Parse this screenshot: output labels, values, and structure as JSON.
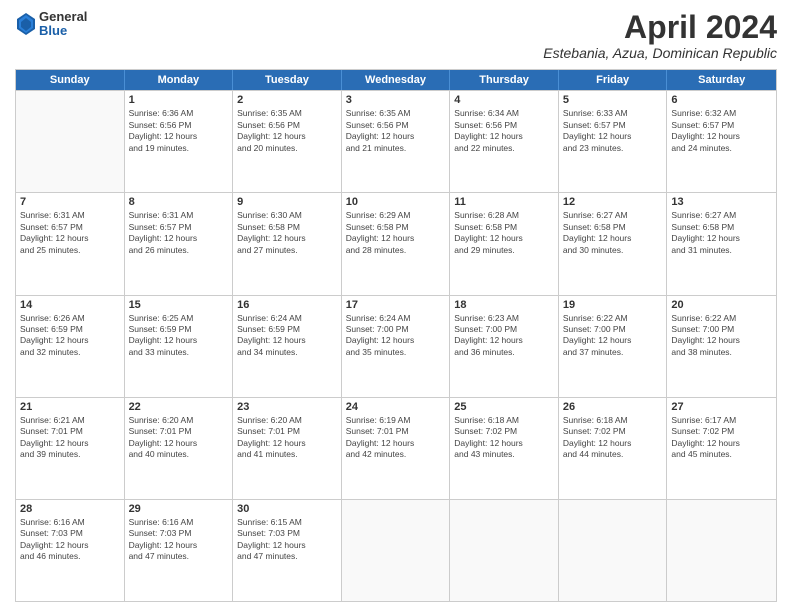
{
  "logo": {
    "general": "General",
    "blue": "Blue"
  },
  "title": "April 2024",
  "location": "Estebania, Azua, Dominican Republic",
  "header_days": [
    "Sunday",
    "Monday",
    "Tuesday",
    "Wednesday",
    "Thursday",
    "Friday",
    "Saturday"
  ],
  "weeks": [
    [
      {
        "day": "",
        "info": ""
      },
      {
        "day": "1",
        "info": "Sunrise: 6:36 AM\nSunset: 6:56 PM\nDaylight: 12 hours\nand 19 minutes."
      },
      {
        "day": "2",
        "info": "Sunrise: 6:35 AM\nSunset: 6:56 PM\nDaylight: 12 hours\nand 20 minutes."
      },
      {
        "day": "3",
        "info": "Sunrise: 6:35 AM\nSunset: 6:56 PM\nDaylight: 12 hours\nand 21 minutes."
      },
      {
        "day": "4",
        "info": "Sunrise: 6:34 AM\nSunset: 6:56 PM\nDaylight: 12 hours\nand 22 minutes."
      },
      {
        "day": "5",
        "info": "Sunrise: 6:33 AM\nSunset: 6:57 PM\nDaylight: 12 hours\nand 23 minutes."
      },
      {
        "day": "6",
        "info": "Sunrise: 6:32 AM\nSunset: 6:57 PM\nDaylight: 12 hours\nand 24 minutes."
      }
    ],
    [
      {
        "day": "7",
        "info": "Sunrise: 6:31 AM\nSunset: 6:57 PM\nDaylight: 12 hours\nand 25 minutes."
      },
      {
        "day": "8",
        "info": "Sunrise: 6:31 AM\nSunset: 6:57 PM\nDaylight: 12 hours\nand 26 minutes."
      },
      {
        "day": "9",
        "info": "Sunrise: 6:30 AM\nSunset: 6:58 PM\nDaylight: 12 hours\nand 27 minutes."
      },
      {
        "day": "10",
        "info": "Sunrise: 6:29 AM\nSunset: 6:58 PM\nDaylight: 12 hours\nand 28 minutes."
      },
      {
        "day": "11",
        "info": "Sunrise: 6:28 AM\nSunset: 6:58 PM\nDaylight: 12 hours\nand 29 minutes."
      },
      {
        "day": "12",
        "info": "Sunrise: 6:27 AM\nSunset: 6:58 PM\nDaylight: 12 hours\nand 30 minutes."
      },
      {
        "day": "13",
        "info": "Sunrise: 6:27 AM\nSunset: 6:58 PM\nDaylight: 12 hours\nand 31 minutes."
      }
    ],
    [
      {
        "day": "14",
        "info": "Sunrise: 6:26 AM\nSunset: 6:59 PM\nDaylight: 12 hours\nand 32 minutes."
      },
      {
        "day": "15",
        "info": "Sunrise: 6:25 AM\nSunset: 6:59 PM\nDaylight: 12 hours\nand 33 minutes."
      },
      {
        "day": "16",
        "info": "Sunrise: 6:24 AM\nSunset: 6:59 PM\nDaylight: 12 hours\nand 34 minutes."
      },
      {
        "day": "17",
        "info": "Sunrise: 6:24 AM\nSunset: 7:00 PM\nDaylight: 12 hours\nand 35 minutes."
      },
      {
        "day": "18",
        "info": "Sunrise: 6:23 AM\nSunset: 7:00 PM\nDaylight: 12 hours\nand 36 minutes."
      },
      {
        "day": "19",
        "info": "Sunrise: 6:22 AM\nSunset: 7:00 PM\nDaylight: 12 hours\nand 37 minutes."
      },
      {
        "day": "20",
        "info": "Sunrise: 6:22 AM\nSunset: 7:00 PM\nDaylight: 12 hours\nand 38 minutes."
      }
    ],
    [
      {
        "day": "21",
        "info": "Sunrise: 6:21 AM\nSunset: 7:01 PM\nDaylight: 12 hours\nand 39 minutes."
      },
      {
        "day": "22",
        "info": "Sunrise: 6:20 AM\nSunset: 7:01 PM\nDaylight: 12 hours\nand 40 minutes."
      },
      {
        "day": "23",
        "info": "Sunrise: 6:20 AM\nSunset: 7:01 PM\nDaylight: 12 hours\nand 41 minutes."
      },
      {
        "day": "24",
        "info": "Sunrise: 6:19 AM\nSunset: 7:01 PM\nDaylight: 12 hours\nand 42 minutes."
      },
      {
        "day": "25",
        "info": "Sunrise: 6:18 AM\nSunset: 7:02 PM\nDaylight: 12 hours\nand 43 minutes."
      },
      {
        "day": "26",
        "info": "Sunrise: 6:18 AM\nSunset: 7:02 PM\nDaylight: 12 hours\nand 44 minutes."
      },
      {
        "day": "27",
        "info": "Sunrise: 6:17 AM\nSunset: 7:02 PM\nDaylight: 12 hours\nand 45 minutes."
      }
    ],
    [
      {
        "day": "28",
        "info": "Sunrise: 6:16 AM\nSunset: 7:03 PM\nDaylight: 12 hours\nand 46 minutes."
      },
      {
        "day": "29",
        "info": "Sunrise: 6:16 AM\nSunset: 7:03 PM\nDaylight: 12 hours\nand 47 minutes."
      },
      {
        "day": "30",
        "info": "Sunrise: 6:15 AM\nSunset: 7:03 PM\nDaylight: 12 hours\nand 47 minutes."
      },
      {
        "day": "",
        "info": ""
      },
      {
        "day": "",
        "info": ""
      },
      {
        "day": "",
        "info": ""
      },
      {
        "day": "",
        "info": ""
      }
    ]
  ]
}
